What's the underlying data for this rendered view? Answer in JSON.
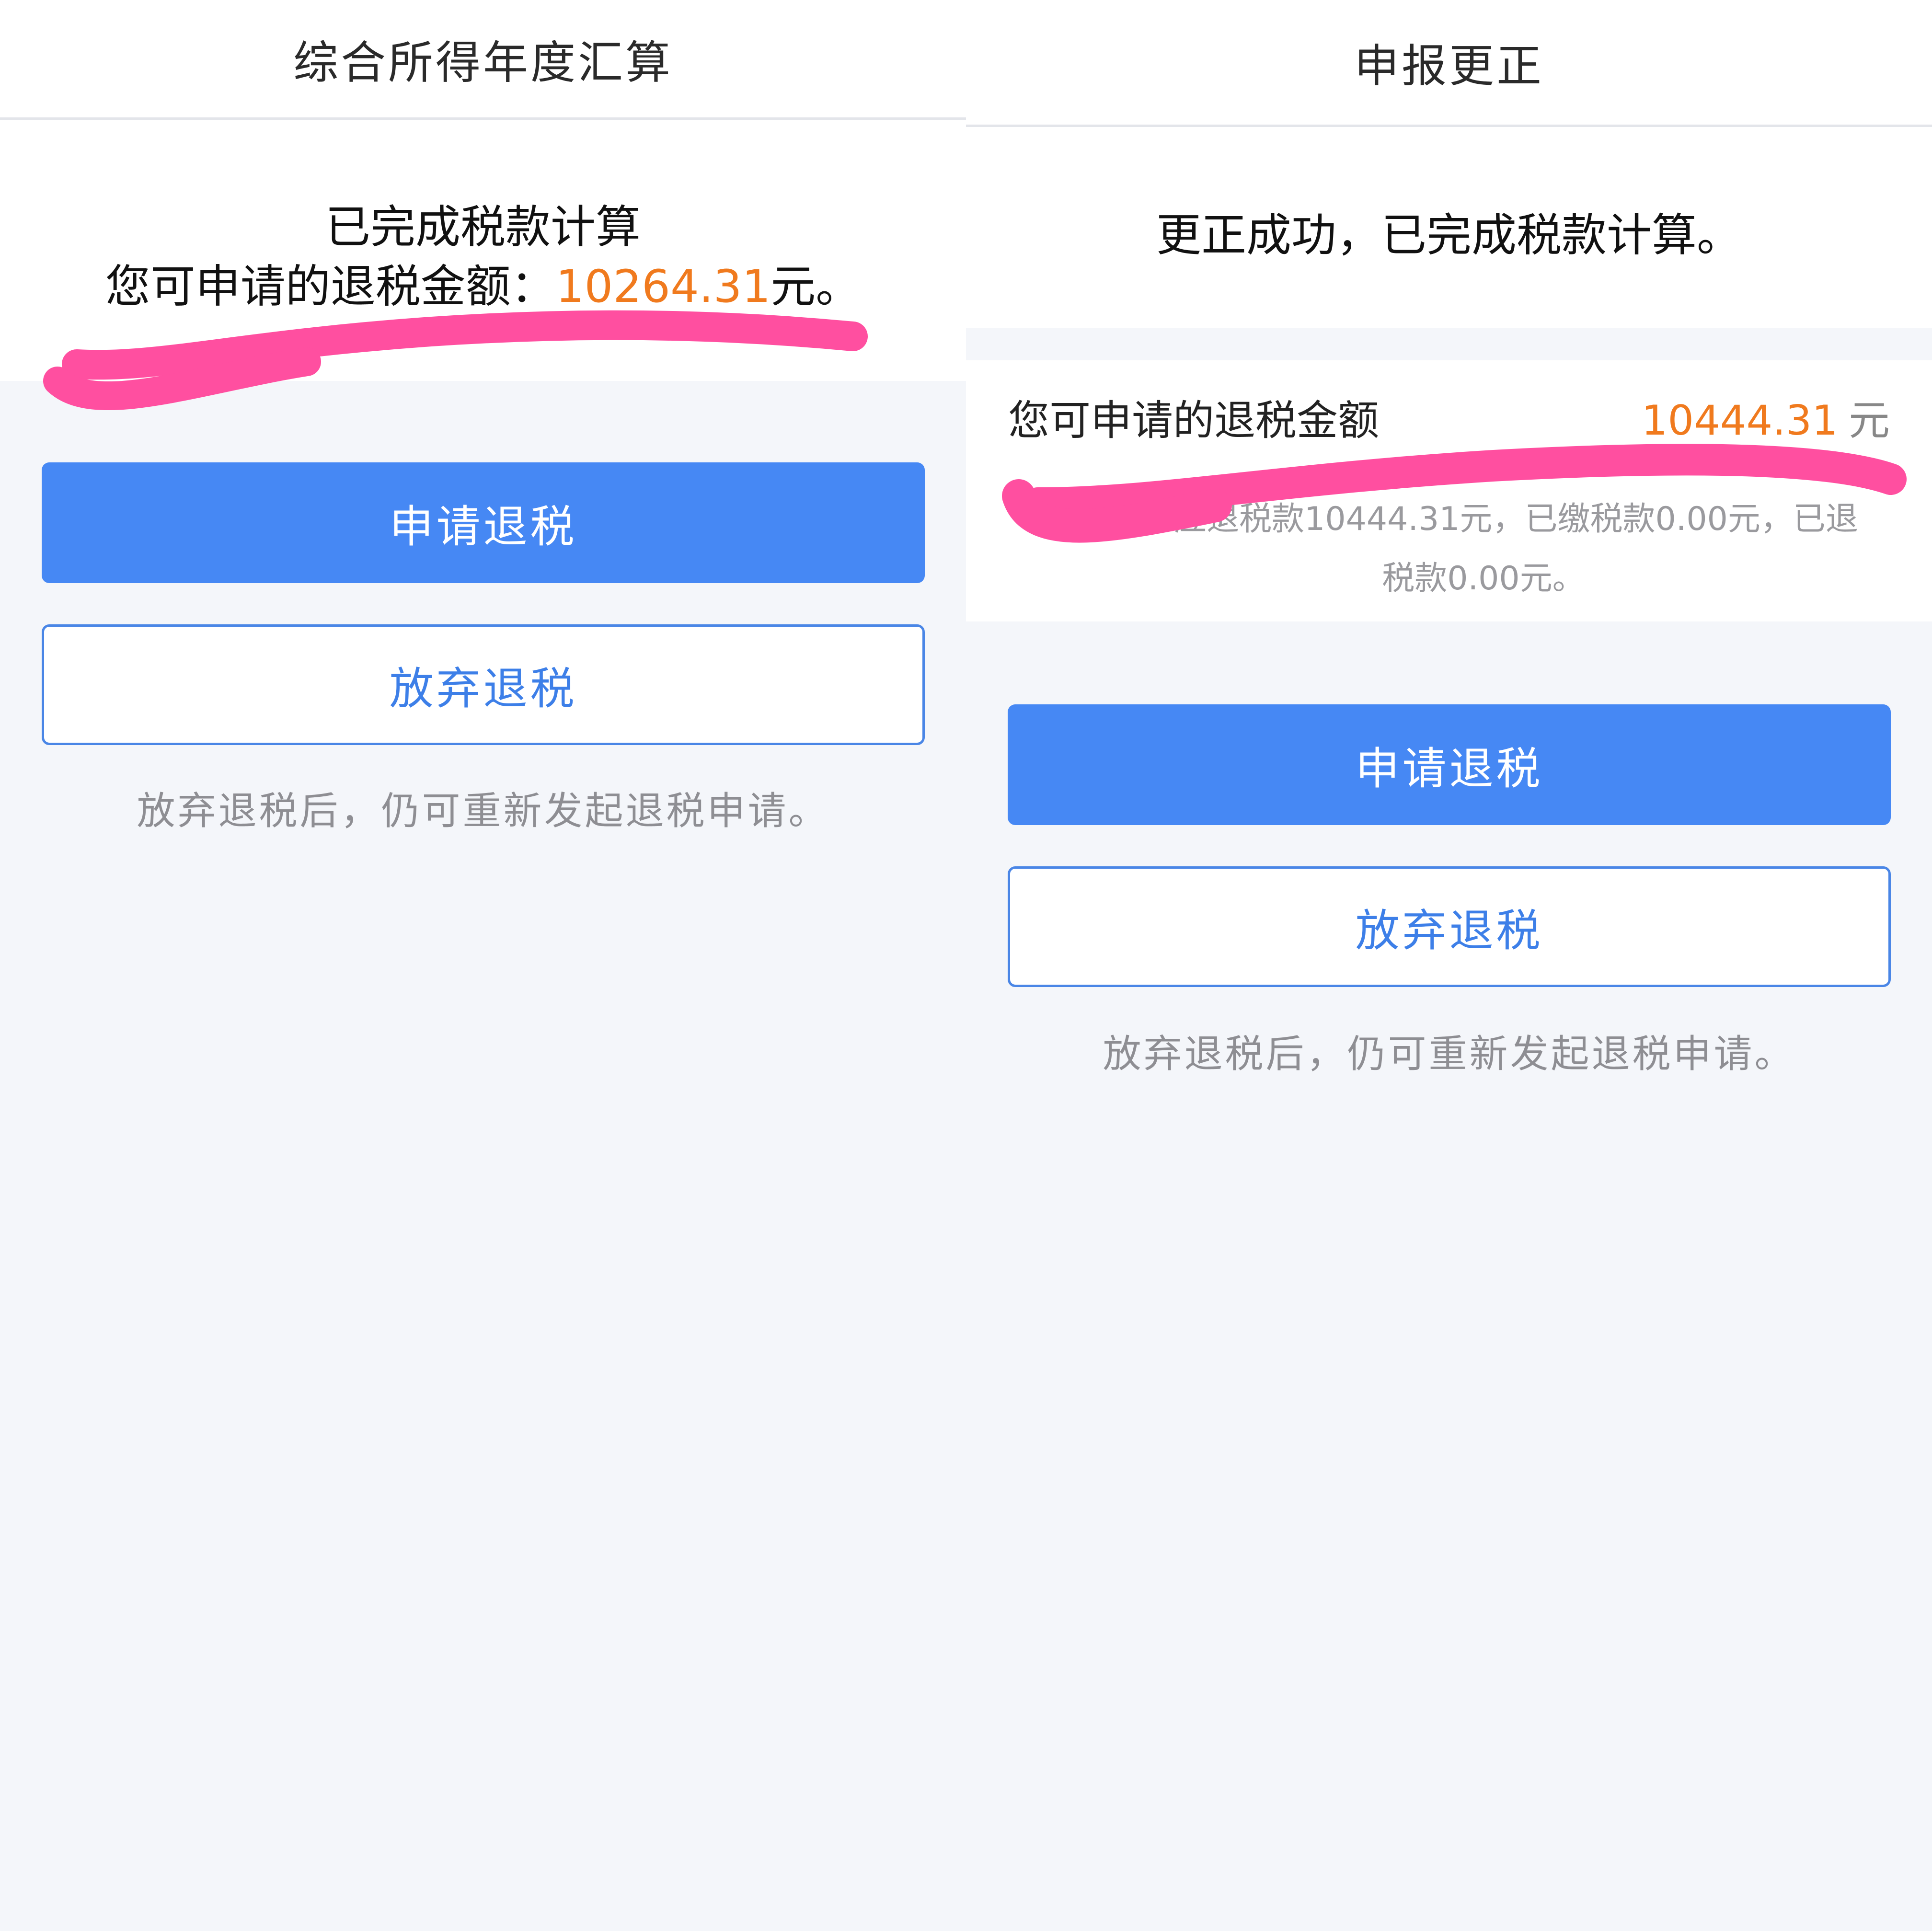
{
  "left": {
    "nav_title": "综合所得年度汇算",
    "result_line1": "已完成税款计算",
    "result_prefix": "您可申请的退税金额：",
    "refund_amount": "10264.31",
    "result_suffix": "元。",
    "apply_button": "申请退税",
    "abandon_button": "放弃退税",
    "hint": "放弃退税后，仍可重新发起退税申请。",
    "scribble_color": "#ff4fa0"
  },
  "right": {
    "nav_title": "申报更正",
    "status_text": "更正成功，已完成税款计算。",
    "amount_label": "您可申请的退税金额",
    "refund_amount": "10444.31",
    "amount_unit": "元",
    "detail_line1": "您的应退税款10444.31元，已缴税款0.00元，已退",
    "detail_line2": "税款0.00元。",
    "apply_button": "申请退税",
    "abandon_button": "放弃退税",
    "hint": "放弃退税后，仍可重新发起退税申请。",
    "scribble_color": "#ff4fa0"
  },
  "colors": {
    "primary": "#4688f4",
    "amount": "#f07a1e",
    "background": "#f4f6fa"
  }
}
